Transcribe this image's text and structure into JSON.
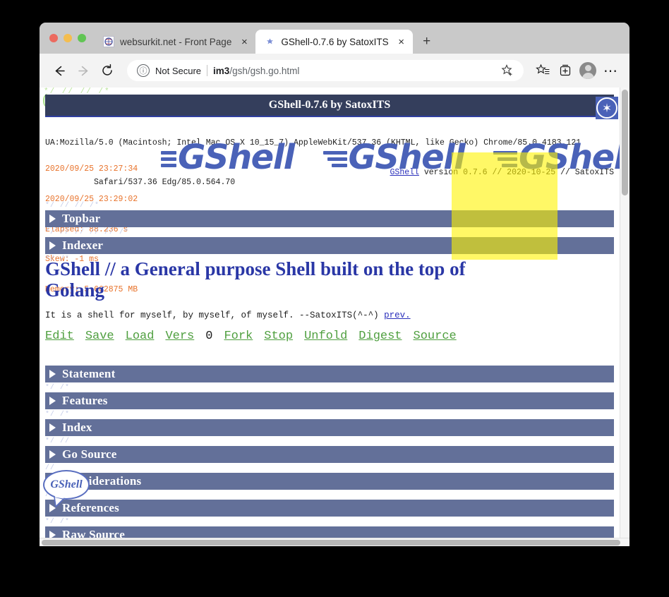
{
  "browser": {
    "tabs": [
      {
        "title": "websurkit.net - Front Page",
        "favicon": "websurkit-favicon",
        "close": "×",
        "active": false
      },
      {
        "title": "GShell-0.7.6 by SatoxITS",
        "favicon": "gshell-favicon",
        "close": "×",
        "active": true
      }
    ],
    "new_tab_label": "+",
    "nav": {
      "back": "←",
      "forward": "→",
      "reload": "↻"
    },
    "address": {
      "security_icon": "ⓘ",
      "security_text": "Not Secure",
      "url_host": "im3",
      "url_path": "/gsh/gsh.go.html",
      "bookmark_icon": "☆"
    },
    "toolbar_icons": {
      "collections": "☆",
      "tabs_panel": "❐",
      "more": "⋯"
    }
  },
  "page": {
    "top_comment": "*/ // // /*",
    "paren": "(",
    "title": "GShell-0.7.6 by SatoxITS",
    "star_badge": "✶",
    "ua_line1": "UA:Mozilla/5.0 (Macintosh; Intel Mac OS X 10_15_7) AppleWebKit/537.36 (KHTML, like Gecko) Chrome/85.0.4183.121",
    "ua_line2": "Safari/537.36 Edg/85.0.564.70",
    "version_link": "GShell",
    "version_rest": " version 0.7.6 // 2020-10-25 // SatoxITS",
    "stats": [
      "2020/09/25 23:27:34",
      "2020/09/25 23:29:02",
      "Elapsed: 88.236 s",
      "Skew: -1 ms",
      "Memory: 5.662875 MB"
    ],
    "logo_word": "GShell",
    "logos_count": 3,
    "top_bars": [
      {
        "comment": "*/ // // /*",
        "label": "Topbar"
      },
      {
        "comment": "*/ // // // // /*",
        "label": "Indexer"
      }
    ],
    "heading": "GShell // a General purpose Shell built on the top of Golang",
    "tagline": "It is a shell for myself, by myself, of myself. --SatoxITS(^-^) ",
    "tagline_link": "prev.",
    "commands": [
      "Edit",
      "Save",
      "Load",
      "Vers"
    ],
    "command_count": "0",
    "commands_after": [
      "Fork",
      "Stop",
      "Unfold",
      "Digest",
      "Source"
    ],
    "section_bars": [
      {
        "comment": "*/ /*",
        "label": "Statement"
      },
      {
        "comment": "*/ /*",
        "label": "Features"
      },
      {
        "comment": "*/ /*",
        "label": "Index"
      },
      {
        "comment": "*/ //",
        "label": "Go Source"
      },
      {
        "comment": "//",
        "label": "Considerations"
      },
      {
        "comment": "// /*",
        "label": "References"
      },
      {
        "comment": "*/ /*",
        "label": "Raw Source"
      }
    ],
    "bubble_label": "GShell"
  },
  "colors": {
    "title_bar": "#343e5c",
    "fold_bar": "#637099",
    "logo_blue": "#4a62b8",
    "heading_blue": "#2a37a6",
    "stat_orange": "#e8722a",
    "command_green": "#4f9f3f",
    "highlight_yellow": "#fff300"
  }
}
